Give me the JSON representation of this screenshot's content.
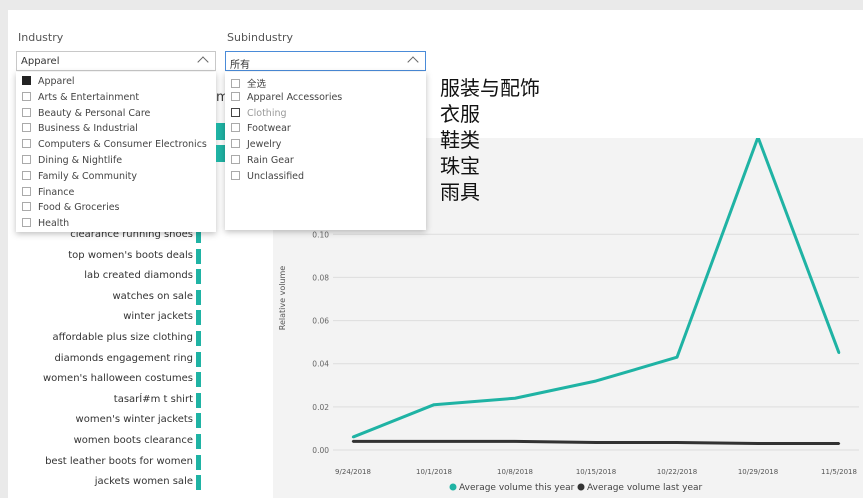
{
  "filters": {
    "industry": {
      "label": "Industry",
      "value": "Apparel",
      "options": [
        {
          "label": "Apparel",
          "checked": true
        },
        {
          "label": "Arts & Entertainment",
          "checked": false
        },
        {
          "label": "Beauty & Personal Care",
          "checked": false
        },
        {
          "label": "Business & Industrial",
          "checked": false
        },
        {
          "label": "Computers & Consumer Electronics",
          "checked": false
        },
        {
          "label": "Dining & Nightlife",
          "checked": false
        },
        {
          "label": "Family & Community",
          "checked": false
        },
        {
          "label": "Finance",
          "checked": false
        },
        {
          "label": "Food & Groceries",
          "checked": false
        },
        {
          "label": "Health",
          "checked": false
        }
      ]
    },
    "subindustry": {
      "label": "Subindustry",
      "value": "所有",
      "options": [
        {
          "label": "全选",
          "checked": false
        },
        {
          "label": "Apparel Accessories",
          "checked": false
        },
        {
          "label": "Clothing",
          "checked": false
        },
        {
          "label": "Footwear",
          "checked": false
        },
        {
          "label": "Jewelry",
          "checked": false
        },
        {
          "label": "Rain Gear",
          "checked": false
        },
        {
          "label": "Unclassified",
          "checked": false
        }
      ]
    }
  },
  "hidden_title_fragment": "m",
  "chinese_overlay": [
    "服装与配饰",
    "衣服",
    "鞋类",
    "珠宝",
    "雨具"
  ],
  "keywords": [
    "clearance running shoes",
    "top women's boots deals",
    "lab created diamonds",
    "watches on sale",
    "winter jackets",
    "affordable plus size clothing",
    "diamonds engagement ring",
    "women's halloween costumes",
    "tasarÍ#m t shirt",
    "women's winter jackets",
    "women boots clearance",
    "best leather boots for women",
    "jackets women sale"
  ],
  "chart_data": {
    "type": "line",
    "x": [
      "9/24/2018",
      "10/1/2018",
      "10/8/2018",
      "10/15/2018",
      "10/22/2018",
      "10/29/2018",
      "11/5/2018"
    ],
    "ylabel": "Relative volume",
    "ylim": [
      0,
      0.14
    ],
    "yticks": [
      "0.00",
      "0.02",
      "0.04",
      "0.06",
      "0.08",
      "0.10"
    ],
    "series": [
      {
        "name": "Average volume this year",
        "color": "#1fb3a4",
        "values": [
          0.006,
          0.021,
          0.024,
          0.032,
          0.043,
          0.145,
          0.045
        ]
      },
      {
        "name": "Average volume last year",
        "color": "#333333",
        "values": [
          0.004,
          0.004,
          0.004,
          0.0035,
          0.0035,
          0.003,
          0.003
        ]
      }
    ],
    "legend_position": "bottom"
  },
  "colors": {
    "accent": "#1fb3a4",
    "dark_series": "#333333",
    "focus_border": "#4a8bd8"
  }
}
